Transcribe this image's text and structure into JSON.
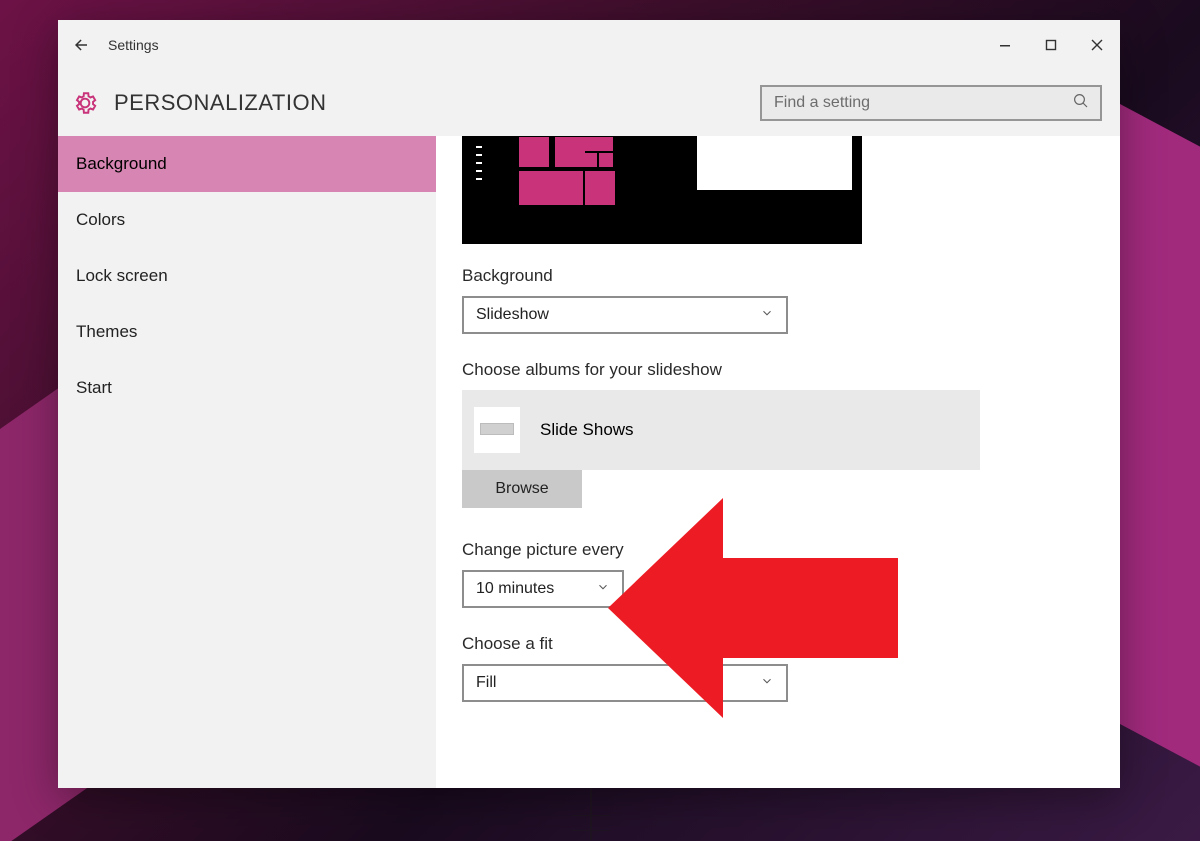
{
  "titlebar": {
    "app_name": "Settings"
  },
  "header": {
    "page_title": "PERSONALIZATION",
    "search_placeholder": "Find a setting"
  },
  "sidebar": {
    "items": [
      {
        "label": "Background",
        "active": true
      },
      {
        "label": "Colors",
        "active": false
      },
      {
        "label": "Lock screen",
        "active": false
      },
      {
        "label": "Themes",
        "active": false
      },
      {
        "label": "Start",
        "active": false
      }
    ]
  },
  "content": {
    "background_label": "Background",
    "background_value": "Slideshow",
    "albums_label": "Choose albums for your slideshow",
    "album_name": "Slide Shows",
    "browse_label": "Browse",
    "interval_label": "Change picture every",
    "interval_value": "10 minutes",
    "fit_label": "Choose a fit",
    "fit_value": "Fill"
  },
  "colors": {
    "accent": "#C8337A",
    "sidebar_active": "#D785B2",
    "annotation_arrow": "#ED1C24"
  }
}
